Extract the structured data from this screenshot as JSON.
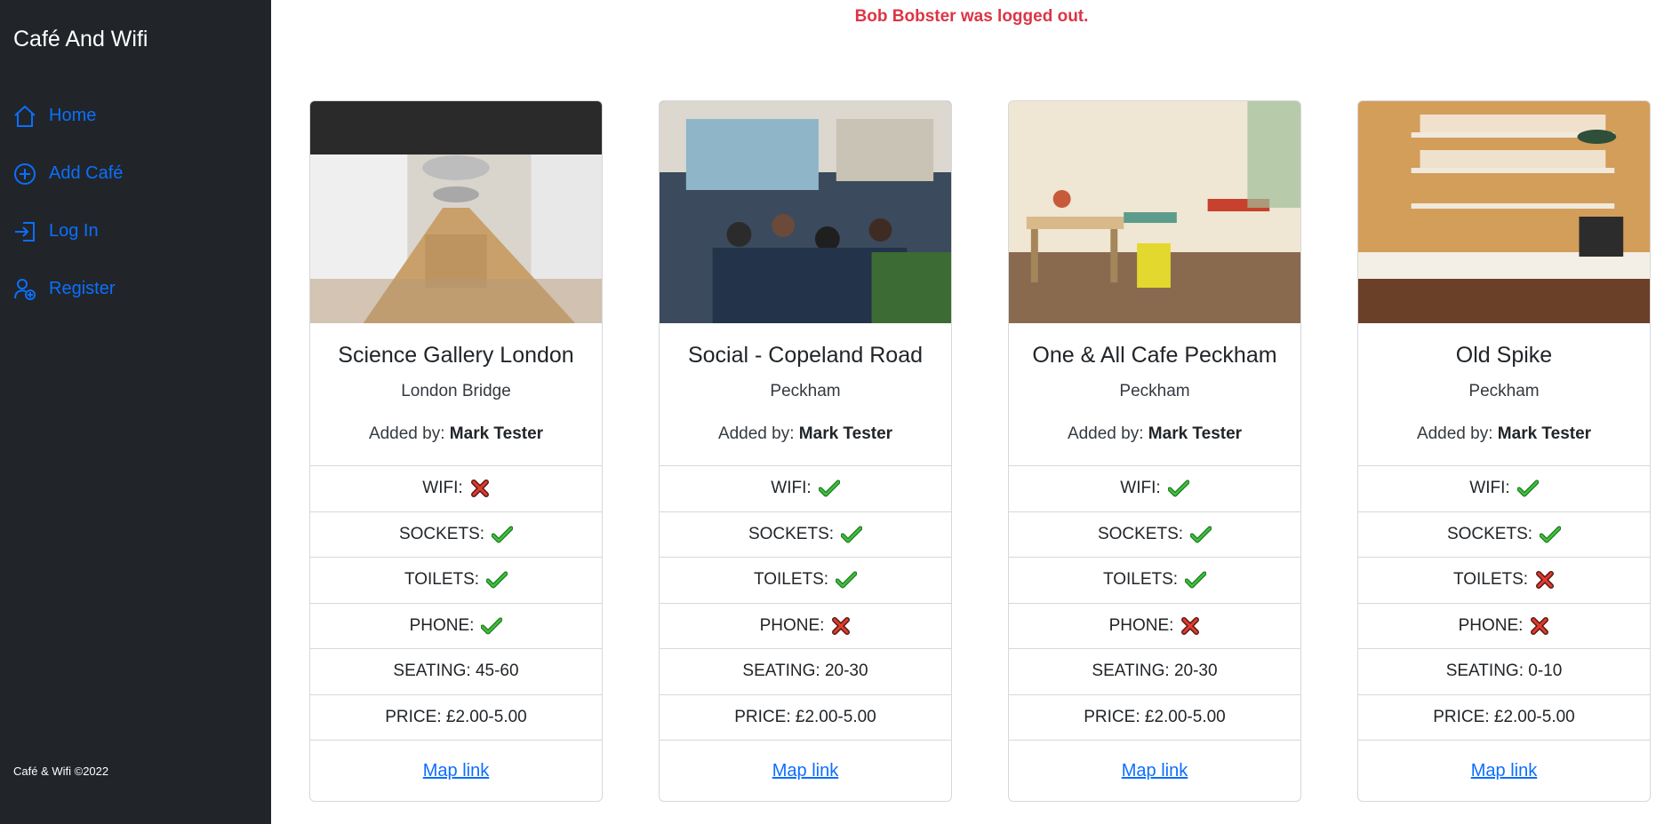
{
  "app": {
    "brand": "Café And Wifi",
    "footer": "Café & Wifi ©2022"
  },
  "nav": [
    {
      "label": "Home",
      "icon": "house-icon"
    },
    {
      "label": "Add Café",
      "icon": "plus-circle-icon"
    },
    {
      "label": "Log In",
      "icon": "login-icon"
    },
    {
      "label": "Register",
      "icon": "person-add-icon"
    }
  ],
  "flash": "Bob Bobster was logged out.",
  "added_by_prefix": "Added by:",
  "map_link_label": "Map link",
  "colors": {
    "sidebar_bg": "#212529",
    "link": "#0d6efd",
    "flash": "#dc3545",
    "yes": "#2a9d2a",
    "no": "#e23b2e"
  },
  "cafes": [
    {
      "name": "Science Gallery London",
      "location": "London Bridge",
      "added_by": "Mark Tester",
      "image": "long-dining-hall-photo",
      "wifi": "no",
      "sockets": "yes",
      "toilets": "yes",
      "phone": "yes",
      "seating": "SEATING: 45-60",
      "price": "PRICE: £2.00-5.00"
    },
    {
      "name": "Social - Copeland Road",
      "location": "Peckham",
      "added_by": "Mark Tester",
      "image": "busy-cafe-terrace-photo",
      "wifi": "yes",
      "sockets": "yes",
      "toilets": "yes",
      "phone": "no",
      "seating": "SEATING: 20-30",
      "price": "PRICE: £2.00-5.00"
    },
    {
      "name": "One & All Cafe Peckham",
      "location": "Peckham",
      "added_by": "Mark Tester",
      "image": "small-cafe-tables-photo",
      "wifi": "yes",
      "sockets": "yes",
      "toilets": "yes",
      "phone": "no",
      "seating": "SEATING: 20-30",
      "price": "PRICE: £2.00-5.00"
    },
    {
      "name": "Old Spike",
      "location": "Peckham",
      "added_by": "Mark Tester",
      "image": "coffee-bar-shelves-photo",
      "wifi": "yes",
      "sockets": "yes",
      "toilets": "no",
      "phone": "no",
      "seating": "SEATING: 0-10",
      "price": "PRICE: £2.00-5.00"
    }
  ],
  "amenity_labels": {
    "wifi": "WIFI:",
    "sockets": "SOCKETS:",
    "toilets": "TOILETS:",
    "phone": "PHONE:"
  }
}
